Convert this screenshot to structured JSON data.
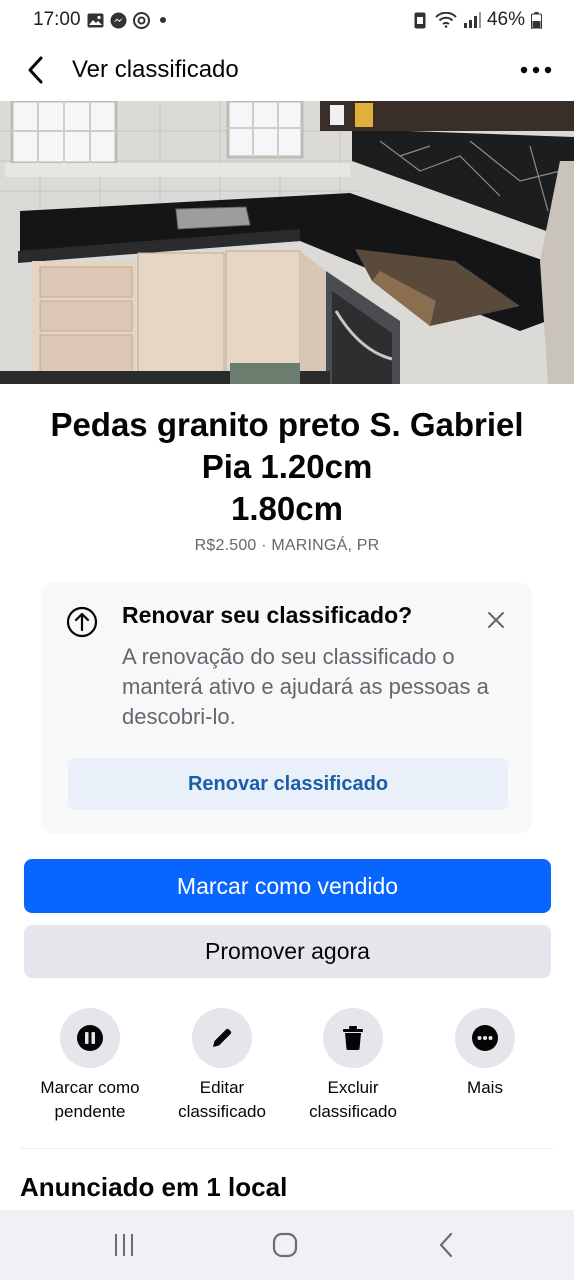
{
  "status_bar": {
    "time": "17:00",
    "battery": "46%"
  },
  "header": {
    "title": "Ver classificado"
  },
  "listing": {
    "title_lines": [
      "Pedas granito preto S. Gabriel",
      "Pia 1.20cm",
      "1.80cm"
    ],
    "price": "R$2.500",
    "separator": "·",
    "location": "MARINGÁ, PR"
  },
  "renew_card": {
    "title": "Renovar seu classificado?",
    "description": "A renovação do seu classificado o manterá ativo e ajudará as pessoas a descobri-lo.",
    "button_label": "Renovar classificado"
  },
  "buttons": {
    "mark_sold": "Marcar como vendido",
    "promote": "Promover agora"
  },
  "actions": [
    {
      "label_line1": "Marcar como",
      "label_line2": "pendente",
      "icon": "pause-icon"
    },
    {
      "label_line1": "Editar",
      "label_line2": "classificado",
      "icon": "pencil-icon"
    },
    {
      "label_line1": "Excluir",
      "label_line2": "classificado",
      "icon": "trash-icon"
    },
    {
      "label_line1": "Mais",
      "label_line2": "",
      "icon": "more-horizontal-icon"
    }
  ],
  "section": {
    "title": "Anunciado em 1 local"
  },
  "colors": {
    "primary": "#0866ff",
    "secondary_bg": "#e4e6eb",
    "renew_button_text": "#1b5ea8",
    "muted_text": "#65676b"
  }
}
